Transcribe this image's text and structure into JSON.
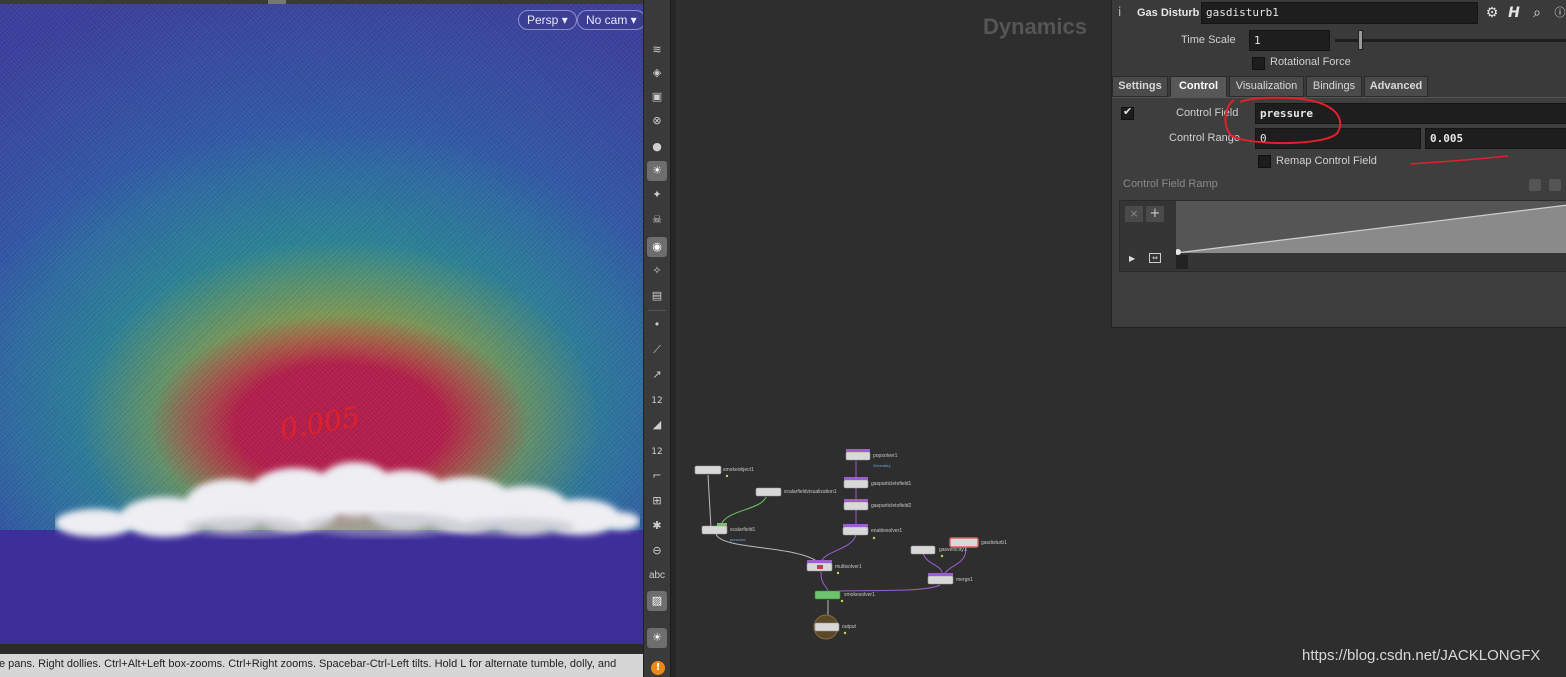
{
  "viewport": {
    "camera_menu": "Persp",
    "cam_menu": "No cam",
    "annotation_text": "0.005",
    "status_text": "e pans. Right dollies. Ctrl+Alt+Left box-zooms. Ctrl+Right zooms. Spacebar-Ctrl-Left tilts. Hold L for alternate tumble, dolly, and"
  },
  "toolbar": {
    "count_label": "12",
    "count_label2": "12",
    "abc_label": "abc"
  },
  "network": {
    "context_label": "Dynamics",
    "nodes": [
      {
        "name": "smokeobject1"
      },
      {
        "name": "scalarfieldvisualization1"
      },
      {
        "name": "scalarfield1",
        "sub": "pressure"
      },
      {
        "name": "popsolver1",
        "sub": "Geometry"
      },
      {
        "name": "gasparticletofield1"
      },
      {
        "name": "gasparticletofield2"
      },
      {
        "name": "enablesolver1"
      },
      {
        "name": "multisolver1"
      },
      {
        "name": "gasvelocity1"
      },
      {
        "name": "gasdisturb1"
      },
      {
        "name": "merge1"
      },
      {
        "name": "smokesolver1"
      },
      {
        "name": "output"
      }
    ]
  },
  "params": {
    "node_type": "Gas Disturb",
    "node_name": "gasdisturb1",
    "time_scale_label": "Time Scale",
    "time_scale_value": "1",
    "rotational_force_label": "Rotational Force",
    "tabs": [
      "Settings",
      "Control",
      "Visualization",
      "Bindings",
      "Advanced"
    ],
    "active_tab": "Control",
    "control_field_label": "Control Field",
    "control_field_value": "pressure",
    "control_range_label": "Control Range",
    "control_range_min": "0",
    "control_range_max": "0.005",
    "remap_label": "Remap Control Field",
    "ramp_label": "Control Field Ramp"
  },
  "watermark": "https://blog.csdn.net/JACKLONGFX",
  "colors": {
    "accent_red": "#e0202a",
    "node_purple": "#9b5fd0",
    "node_green": "#6cc46c",
    "field_bg": "#1e1e1e"
  }
}
